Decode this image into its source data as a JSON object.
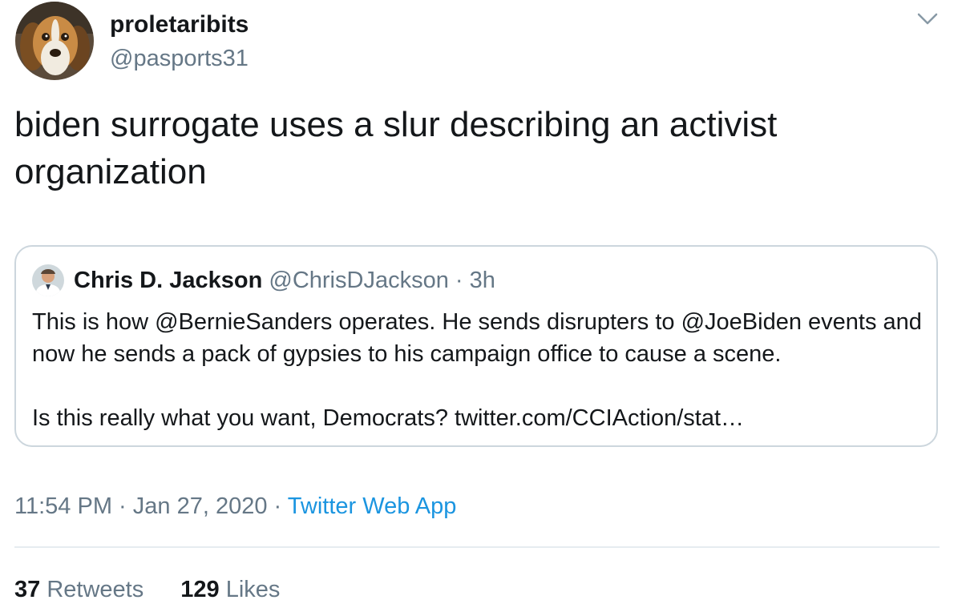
{
  "author": {
    "display_name": "proletaribits",
    "handle": "@pasports31",
    "avatar_icon": "beagle-dog-avatar"
  },
  "menu": {
    "icon": "chevron-down-icon"
  },
  "tweet": {
    "text": "biden surrogate uses a slur describing an activist\norganization"
  },
  "quoted_tweet": {
    "author_name": "Chris D. Jackson",
    "author_handle": "@ChrisDJackson",
    "separator": "·",
    "time_ago": "3h",
    "avatar_icon": "person-avatar",
    "paragraph_1": "This is how @BernieSanders operates. He sends disrupters to @JoeBiden events and now he sends a pack of gypsies to his campaign office to cause a scene.",
    "paragraph_2": "Is this really what you want, Democrats? twitter.com/CCIAction/stat…"
  },
  "meta": {
    "time": "11:54 PM",
    "sep1": "·",
    "date": "Jan 27, 2020",
    "sep2": "·",
    "source": "Twitter Web App"
  },
  "stats": {
    "retweets_count": "37",
    "retweets_label": "Retweets",
    "likes_count": "129",
    "likes_label": "Likes"
  },
  "colors": {
    "text_primary": "#14171a",
    "text_secondary": "#657786",
    "link": "#1b95e0",
    "border": "#ccd6dd",
    "divider": "#e6ecf0"
  }
}
